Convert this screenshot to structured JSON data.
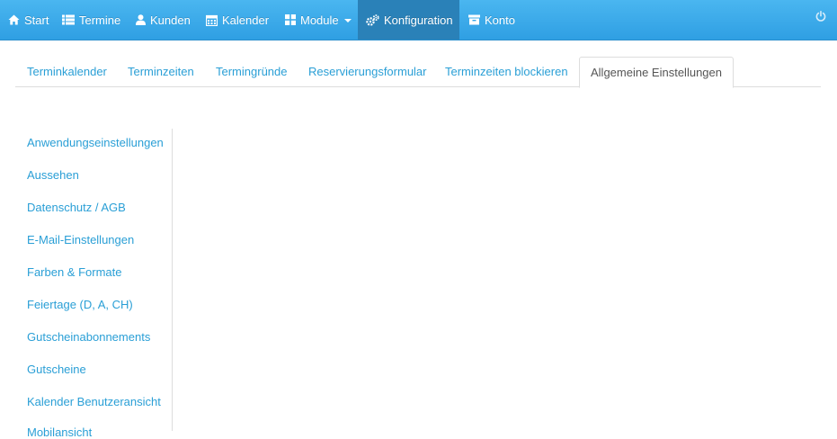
{
  "navbar": {
    "items": [
      {
        "label": "Start",
        "icon": "home-icon"
      },
      {
        "label": "Termine",
        "icon": "list-icon"
      },
      {
        "label": "Kunden",
        "icon": "user-icon"
      },
      {
        "label": "Kalender",
        "icon": "calendar-icon"
      },
      {
        "label": "Module",
        "icon": "grid-icon",
        "dropdown": true
      },
      {
        "label": "Konfiguration",
        "icon": "cogs-icon",
        "active": true
      },
      {
        "label": "Konto",
        "icon": "archive-icon"
      }
    ],
    "logout_icon": "power-icon",
    "colors": {
      "bar": "#35a6e8",
      "active": "#2a81b8",
      "text": "#ffffff"
    }
  },
  "tabs": [
    {
      "label": "Terminkalender"
    },
    {
      "label": "Terminzeiten"
    },
    {
      "label": "Termingründe"
    },
    {
      "label": "Reservierungsformular"
    },
    {
      "label": "Terminzeiten blockieren"
    },
    {
      "label": "Allgemeine Einstellungen",
      "active": true
    }
  ],
  "settings_menu": {
    "items": [
      "Anwendungseinstellungen",
      "Aussehen",
      "Datenschutz / AGB",
      "E-Mail-Einstellungen",
      "Farben & Formate",
      "Feiertage (D, A, CH)",
      "Gutscheinabonnements",
      "Gutscheine",
      "Kalender Benutzeransicht",
      "Mobilansicht"
    ]
  },
  "colors": {
    "link": "#2a9fd6",
    "active_tab_text": "#555555",
    "border": "#dddddd"
  }
}
